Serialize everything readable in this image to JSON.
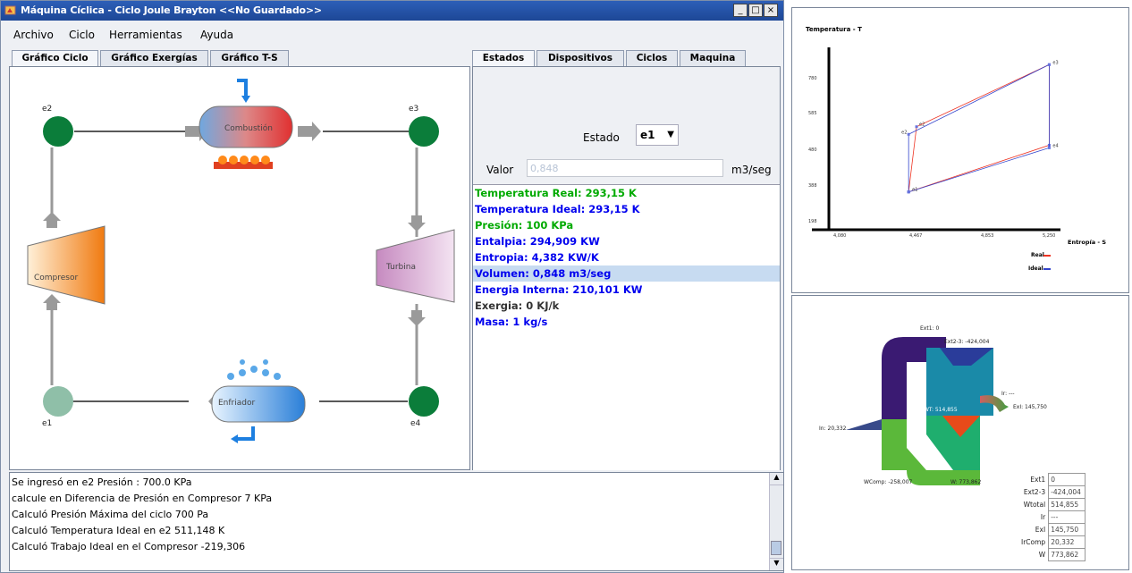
{
  "window": {
    "title": "Máquina Cíclica - Ciclo Joule Brayton <<No Guardado>>",
    "buttons": [
      "_",
      "□",
      "×"
    ]
  },
  "menu": [
    "Archivo",
    "Ciclo",
    "Herramientas",
    "Ayuda"
  ],
  "left_tabs": [
    "Gráfico Ciclo",
    "Gráfico Exergías",
    "Gráfico T-S"
  ],
  "right_tabs": [
    "Estados",
    "Dispositivos",
    "Ciclos",
    "Maquina"
  ],
  "diagram": {
    "nodes": {
      "e2": "e2",
      "e3": "e3",
      "e1": "e1",
      "e4": "e4"
    },
    "devices": {
      "combustion": "Combustión",
      "compressor": "Compresor",
      "turbine": "Turbina",
      "cooler": "Enfriador"
    }
  },
  "estado": {
    "label": "Estado",
    "selected": "e1",
    "valor_label": "Valor",
    "valor_value": "0,848",
    "unit": "m3/seg"
  },
  "properties": [
    {
      "text": "Temperatura Real: 293,15 K",
      "color": "#00aa00"
    },
    {
      "text": "Temperatura Ideal: 293,15 K",
      "color": "#0000ee"
    },
    {
      "text": "Presión: 100 KPa",
      "color": "#00aa00"
    },
    {
      "text": "Entalpia: 294,909 KW",
      "color": "#0000ee"
    },
    {
      "text": "Entropia: 4,382 KW/K",
      "color": "#0000ee"
    },
    {
      "text": "Volumen: 0,848 m3/seg",
      "color": "#0000ee"
    },
    {
      "text": "Energia Interna: 210,101 KW",
      "color": "#0000ee"
    },
    {
      "text": "Exergia: 0 KJ/k",
      "color": "#333333"
    },
    {
      "text": "Masa: 1 kg/s",
      "color": "#0000ee"
    }
  ],
  "log": [
    "Se ingresó en e2 Presión : 700.0 KPa",
    "calcule en Diferencia de Presión en  Compresor 7 KPa",
    "Calculó Presión Máxima del ciclo 700 Pa",
    "Calculó Temperatura Ideal en e2 511,148 K",
    "Calculó Trabajo Ideal en el Compresor -219,306"
  ],
  "ts_chart": {
    "ylabel": "Temperatura - T",
    "xlabel": "Entropía - S",
    "yticks": [
      "780",
      "585",
      "480",
      "388",
      "198"
    ],
    "xticks": [
      "4,080",
      "4,467",
      "4,853",
      "5,250"
    ],
    "legend": [
      "Real",
      "Ideal"
    ],
    "point_labels": [
      "e3",
      "e4",
      "e2",
      "e2",
      "e1"
    ],
    "colors": {
      "real": "#ee3322",
      "ideal": "#3344cc"
    }
  },
  "chart_data": {
    "type": "line",
    "ylabel": "Temperatura - T",
    "xlabel": "Entropía - S",
    "xlim": [
      3.9,
      5.3
    ],
    "ylim": [
      150,
      820
    ],
    "series": [
      {
        "name": "Real",
        "points": [
          [
            4.382,
            293.15
          ],
          [
            4.43,
            540
          ],
          [
            5.232,
            775
          ],
          [
            5.232,
            470
          ],
          [
            4.382,
            293.15
          ]
        ]
      },
      {
        "name": "Ideal",
        "points": [
          [
            4.382,
            293.15
          ],
          [
            4.382,
            511.15
          ],
          [
            5.232,
            775
          ],
          [
            5.232,
            460
          ],
          [
            4.382,
            293.15
          ]
        ]
      }
    ]
  },
  "exergy": {
    "labels": {
      "ext1": "Ext1: 0",
      "ext23": "Ext2-3: -424,004",
      "vt": "WT: 514,855",
      "ir": "Ir: ---",
      "exl": "ExI: 145,750",
      "in": "In: 20,332",
      "wcomp": "WComp: -258,007",
      "w": "W: 773,862"
    },
    "table": [
      {
        "k": "Ext1",
        "v": "0"
      },
      {
        "k": "Ext2-3",
        "v": "-424,004"
      },
      {
        "k": "Wtotal",
        "v": "514,855"
      },
      {
        "k": "Ir",
        "v": "---"
      },
      {
        "k": "ExI",
        "v": "145,750"
      },
      {
        "k": "IrComp",
        "v": "20,332"
      },
      {
        "k": "W",
        "v": "773,862"
      }
    ]
  }
}
